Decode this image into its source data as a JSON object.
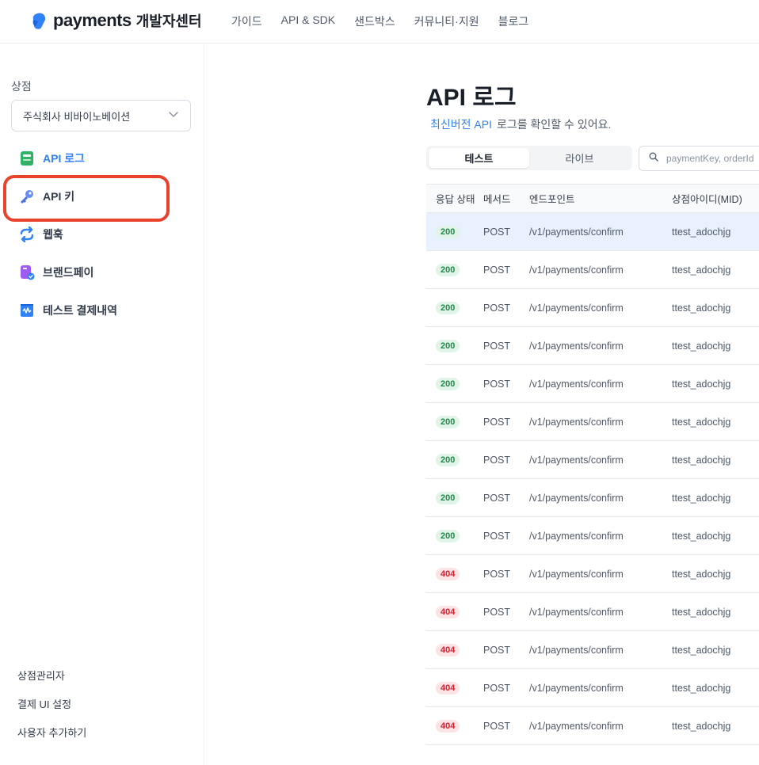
{
  "header": {
    "logo_text": "payments",
    "logo_sub": "개발자센터",
    "nav": [
      "가이드",
      "API & SDK",
      "샌드박스",
      "커뮤니티·지원",
      "블로그"
    ]
  },
  "sidebar": {
    "shop_label": "상점",
    "shop_value": "주식회사 비바이노베이션",
    "items": [
      {
        "label": "API 로그",
        "icon": "api-log-icon"
      },
      {
        "label": "API 키",
        "icon": "key-icon"
      },
      {
        "label": "웹훅",
        "icon": "webhook-icon"
      },
      {
        "label": "브랜드페이",
        "icon": "brandpay-icon"
      },
      {
        "label": "테스트 결제내역",
        "icon": "receipt-icon"
      }
    ],
    "bottom_links": [
      "상점관리자",
      "결제 UI 설정",
      "사용자 추가하기"
    ]
  },
  "main": {
    "title": "API 로그",
    "subtitle_link": "최신버전 API",
    "subtitle_rest": "로그를 확인할 수 있어요.",
    "tabs": [
      "테스트",
      "라이브"
    ],
    "search_placeholder": "paymentKey, orderId",
    "columns": [
      "응답 상태",
      "메서드",
      "엔드포인트",
      "상점아이디(MID)"
    ],
    "rows": [
      {
        "status": "200",
        "method": "POST",
        "endpoint": "/v1/payments/confirm",
        "mid": "ttest_adochjg"
      },
      {
        "status": "200",
        "method": "POST",
        "endpoint": "/v1/payments/confirm",
        "mid": "ttest_adochjg"
      },
      {
        "status": "200",
        "method": "POST",
        "endpoint": "/v1/payments/confirm",
        "mid": "ttest_adochjg"
      },
      {
        "status": "200",
        "method": "POST",
        "endpoint": "/v1/payments/confirm",
        "mid": "ttest_adochjg"
      },
      {
        "status": "200",
        "method": "POST",
        "endpoint": "/v1/payments/confirm",
        "mid": "ttest_adochjg"
      },
      {
        "status": "200",
        "method": "POST",
        "endpoint": "/v1/payments/confirm",
        "mid": "ttest_adochjg"
      },
      {
        "status": "200",
        "method": "POST",
        "endpoint": "/v1/payments/confirm",
        "mid": "ttest_adochjg"
      },
      {
        "status": "200",
        "method": "POST",
        "endpoint": "/v1/payments/confirm",
        "mid": "ttest_adochjg"
      },
      {
        "status": "200",
        "method": "POST",
        "endpoint": "/v1/payments/confirm",
        "mid": "ttest_adochjg"
      },
      {
        "status": "404",
        "method": "POST",
        "endpoint": "/v1/payments/confirm",
        "mid": "ttest_adochjg"
      },
      {
        "status": "404",
        "method": "POST",
        "endpoint": "/v1/payments/confirm",
        "mid": "ttest_adochjg"
      },
      {
        "status": "404",
        "method": "POST",
        "endpoint": "/v1/payments/confirm",
        "mid": "ttest_adochjg"
      },
      {
        "status": "404",
        "method": "POST",
        "endpoint": "/v1/payments/confirm",
        "mid": "ttest_adochjg"
      },
      {
        "status": "404",
        "method": "POST",
        "endpoint": "/v1/payments/confirm",
        "mid": "ttest_adochjg"
      }
    ]
  },
  "colors": {
    "accent": "#3182f6",
    "highlight": "#e8412c",
    "success": "#1f8a4c",
    "error": "#d22030"
  }
}
